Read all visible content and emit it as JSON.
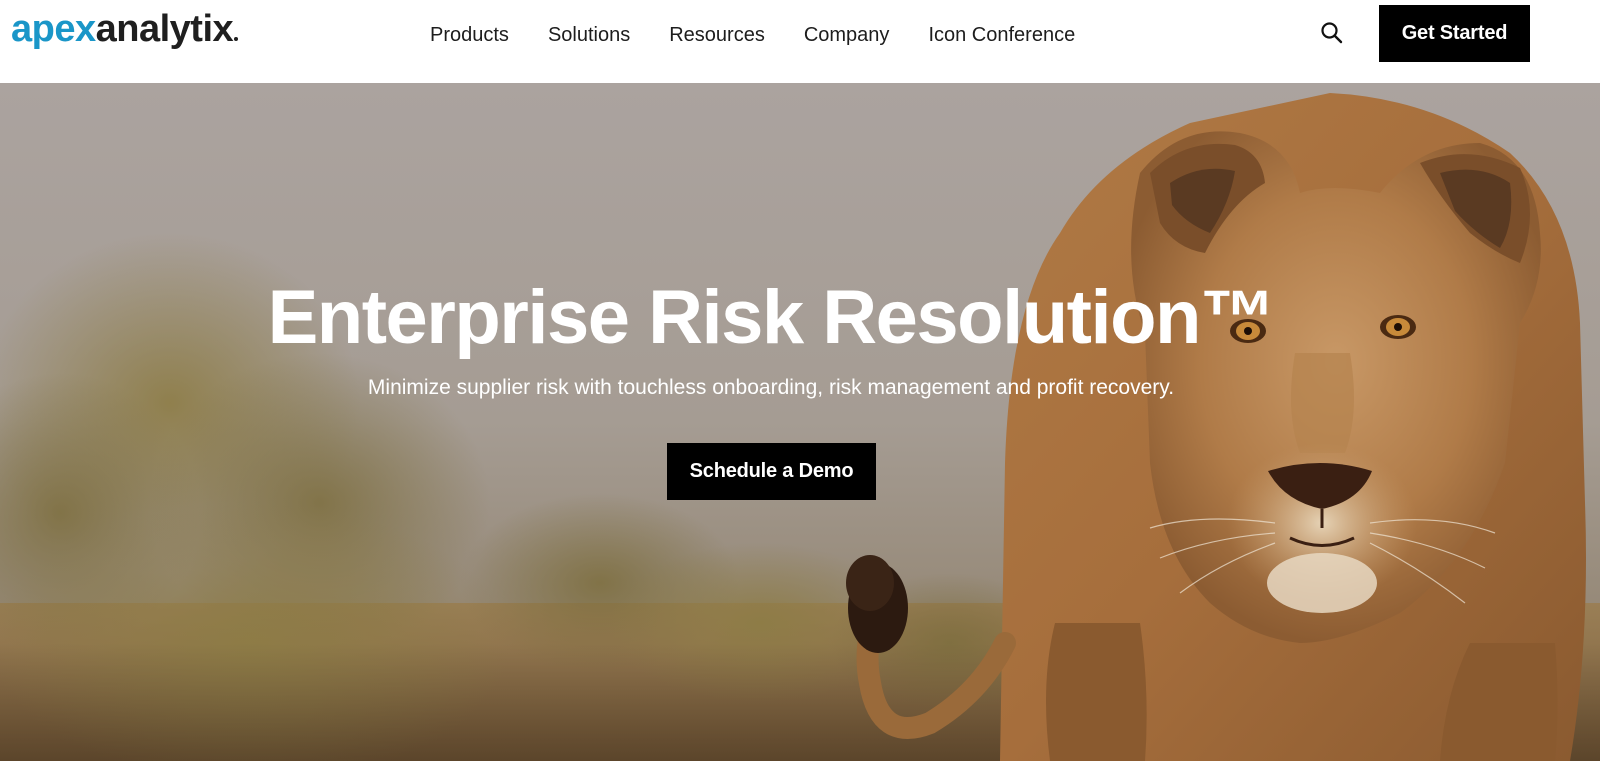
{
  "header": {
    "logo": {
      "part1": "apex",
      "part2": "analytix"
    },
    "nav": [
      {
        "label": "Products"
      },
      {
        "label": "Solutions"
      },
      {
        "label": "Resources"
      },
      {
        "label": "Company"
      },
      {
        "label": "Icon Conference"
      }
    ],
    "search_icon": "search-icon",
    "cta_label": "Get Started"
  },
  "hero": {
    "title": "Enterprise Risk Resolution™",
    "subtitle": "Minimize supplier risk with touchless onboarding, risk management and profit recovery.",
    "cta_label": "Schedule a Demo",
    "image_subject": "lioness walking toward camera in savanna"
  },
  "colors": {
    "brand_blue": "#1a96c8",
    "logo_dark": "#1f1f1f",
    "button_bg": "#000000",
    "button_text": "#ffffff",
    "header_bg": "#ffffff"
  }
}
